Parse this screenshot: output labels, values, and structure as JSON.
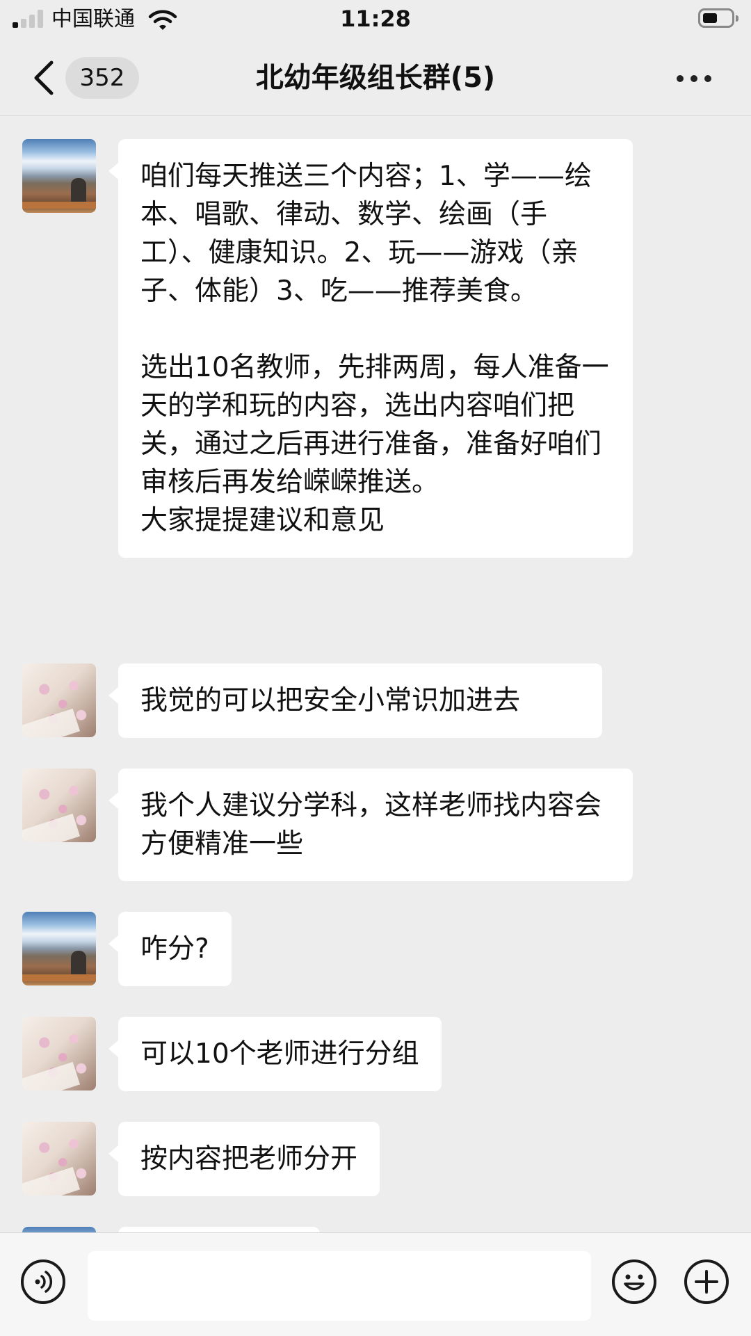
{
  "status_bar": {
    "carrier": "中国联通",
    "time": "11:28",
    "signal_bars_active": 1,
    "battery_level": 0.45
  },
  "nav": {
    "unread_count": "352",
    "title": "北幼年级组长群(5)"
  },
  "messages": [
    {
      "avatar": "sky",
      "text": "咱们每天推送三个内容；1、学——绘本、唱歌、律动、数学、绘画（手工）、健康知识。2、玩——游戏（亲子、体能）3、吃——推荐美食。\n\n选出10名教师，先排两周，每人准备一天的学和玩的内容，选出内容咱们把关，通过之后再进行准备，准备好咱们审核后再发给嵘嵘推送。\n大家提提建议和意见"
    },
    {
      "avatar": "blossom",
      "text": "我觉的可以把安全小常识加进去"
    },
    {
      "avatar": "blossom",
      "text": "我个人建议分学科，这样老师找内容会方便精准一些"
    },
    {
      "avatar": "sky",
      "text": "咋分?"
    },
    {
      "avatar": "blossom",
      "text": "可以10个老师进行分组"
    },
    {
      "avatar": "blossom",
      "text": "按内容把老师分开"
    }
  ],
  "input": {
    "value": "",
    "placeholder": ""
  },
  "icons": {
    "back": "chevron-left-icon",
    "more": "ellipsis-icon",
    "voice": "voice-icon",
    "emoji": "emoji-icon",
    "plus": "plus-icon"
  },
  "colors": {
    "background": "#ededed",
    "bubble": "#ffffff",
    "badge": "#dcdcdc"
  }
}
